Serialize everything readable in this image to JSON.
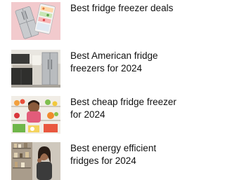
{
  "articles": [
    {
      "title": "Best fridge freezer deals",
      "thumb_icon": "fridge-freezer-deals-thumbnail"
    },
    {
      "title": "Best American fridge freezers for 2024",
      "thumb_icon": "american-fridge-kitchen-thumbnail"
    },
    {
      "title": "Best cheap fridge freezer for 2024",
      "thumb_icon": "fridge-fruit-woman-thumbnail"
    },
    {
      "title": "Best energy efficient fridges for 2024",
      "thumb_icon": "woman-in-kitchen-thumbnail"
    }
  ],
  "colors": {
    "text": "#111111",
    "deals_thumb_bg": "#f2c9cc"
  }
}
